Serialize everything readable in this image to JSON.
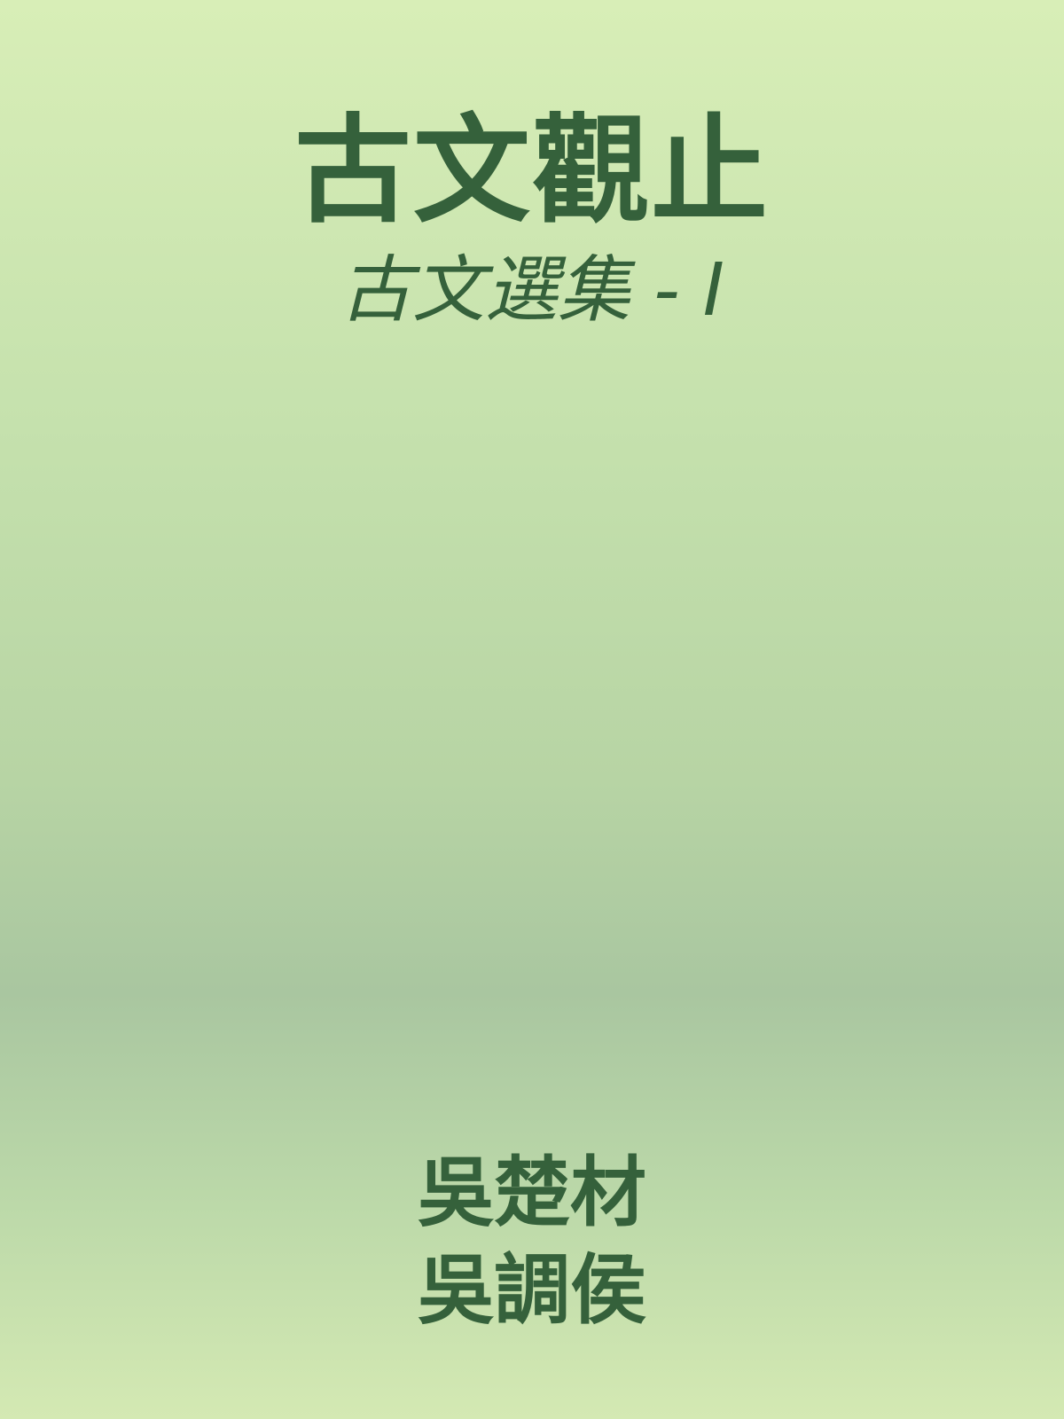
{
  "cover": {
    "title": "古文觀止",
    "subtitle": "古文選集 - I",
    "authors": [
      "吳楚材",
      "吳調侯"
    ],
    "colors": {
      "text": "#35613b",
      "background_top": "#d8eeb7",
      "background_mid": "#a9c6a0",
      "background_bottom": "#d4e9b3"
    }
  }
}
